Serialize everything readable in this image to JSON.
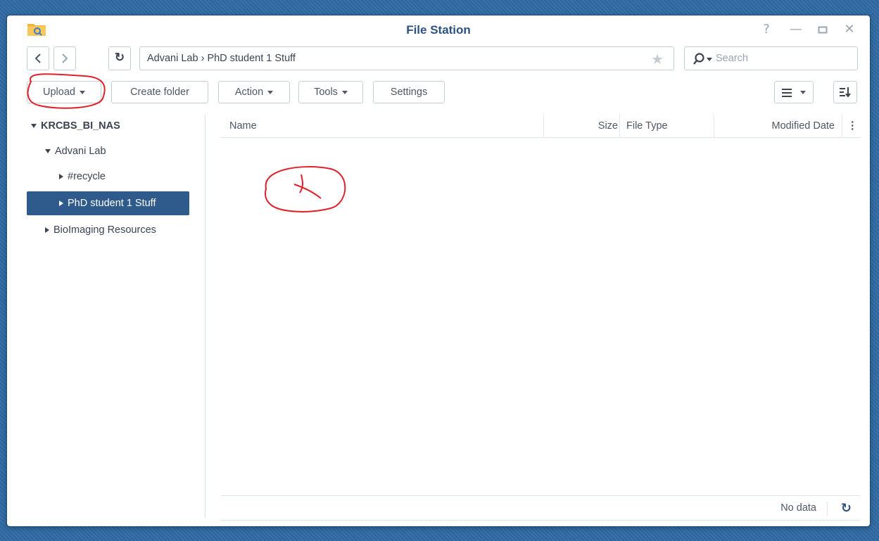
{
  "window": {
    "title": "File Station"
  },
  "nav": {
    "path": "Advani Lab  ›  PhD student 1 Stuff",
    "search_placeholder": "Search"
  },
  "toolbar": {
    "upload_label": "Upload",
    "create_folder_label": "Create folder",
    "action_label": "Action",
    "tools_label": "Tools",
    "settings_label": "Settings"
  },
  "tree": {
    "root": "KRCBS_BI_NAS",
    "items": [
      {
        "label": "Advani Lab"
      },
      {
        "label": "#recycle"
      },
      {
        "label": "PhD student 1 Stuff"
      },
      {
        "label": "BioImaging Resources"
      }
    ]
  },
  "grid": {
    "columns": [
      "Name",
      "Size",
      "File Type",
      "Modified Date"
    ]
  },
  "status": {
    "text": "No data"
  },
  "colors": {
    "accent": "#2e5a8c",
    "desktop": "#2f6aa3",
    "annotation": "#e0202b"
  },
  "icons": [
    "file-station-icon",
    "help-icon",
    "minimize-icon",
    "maximize-icon",
    "close-icon",
    "back-icon",
    "forward-icon",
    "refresh-icon",
    "favorite-star-icon",
    "search-icon",
    "list-view-icon",
    "sort-icon"
  ]
}
